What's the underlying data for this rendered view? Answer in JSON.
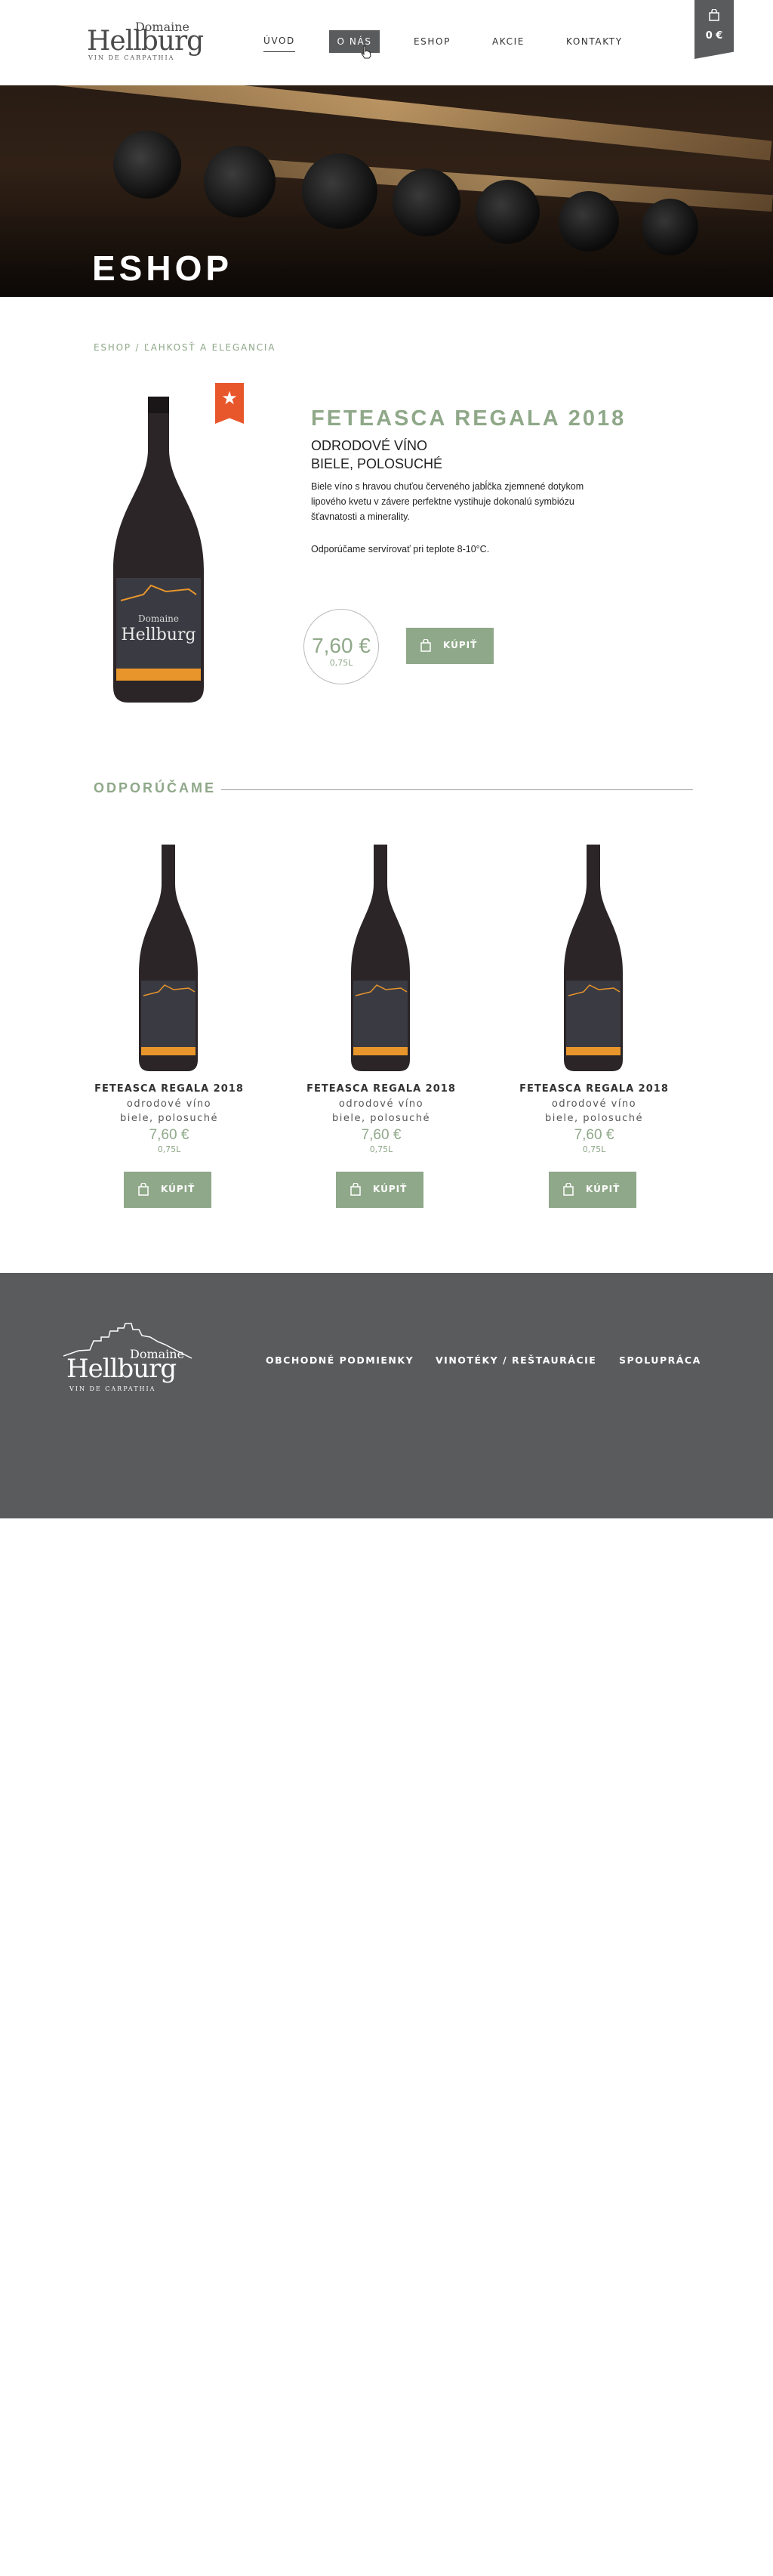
{
  "header": {
    "logo": {
      "line1": "Domaine",
      "line2": "Hellburg",
      "line3": "VIN DE CARPATHIA"
    },
    "nav": [
      {
        "label": "ÚVOD",
        "active": true
      },
      {
        "label": "O NÁS",
        "highlighted": true
      },
      {
        "label": "ESHOP"
      },
      {
        "label": "AKCIE"
      },
      {
        "label": "KONTAKTY"
      }
    ],
    "cart": {
      "icon": "shopping-bag-icon",
      "total": "0 €"
    }
  },
  "hero": {
    "title": "ESHOP"
  },
  "breadcrumb": "ESHOP / ĽAHKOSŤ A ELEGANCIA",
  "product": {
    "badge_icon": "star-icon",
    "name": "FETEASCA REGALA 2018",
    "subtitle_1": "ODRODOVÉ VÍNO",
    "subtitle_2": "BIELE, POLOSUCHÉ",
    "description": "Biele víno s hravou chuťou červeného jabĺčka zjemnené dotykom lipového kvetu v závere perfektne vystihuje dokonalú symbiózu šťavnatosti a minerality.",
    "serving": "Odporúčame servírovať pri teplote 8-10°C.",
    "price": "7,60 €",
    "volume": "0,75L",
    "buy_label": "KÚPIŤ",
    "bottle_label": {
      "line1": "Domaine",
      "line2": "Hellburg"
    }
  },
  "recommended": {
    "title": "ODPORÚČAME",
    "items": [
      {
        "name": "FETEASCA REGALA 2018",
        "type": "odrodové víno",
        "color": "biele, polosuché",
        "price": "7,60 €",
        "volume": "0,75L",
        "buy_label": "KÚPIŤ"
      },
      {
        "name": "FETEASCA REGALA 2018",
        "type": "odrodové víno",
        "color": "biele, polosuché",
        "price": "7,60 €",
        "volume": "0,75L",
        "buy_label": "KÚPIŤ"
      },
      {
        "name": "FETEASCA REGALA 2018",
        "type": "odrodové víno",
        "color": "biele, polosuché",
        "price": "7,60 €",
        "volume": "0,75L",
        "buy_label": "KÚPIŤ"
      }
    ]
  },
  "footer": {
    "logo": {
      "line1": "Domaine",
      "line2": "Hellburg",
      "line3": "VIN DE CARPATHIA"
    },
    "links": [
      "OBCHODNÉ PODMIENKY",
      "VINOTÉKY / REŠTAURÁCIE",
      "SPOLUPRÁCA"
    ]
  },
  "colors": {
    "accent": "#8fa889",
    "dark": "#5a5b5d",
    "badge": "#e8572b",
    "bottle_band": "#e8962b"
  }
}
